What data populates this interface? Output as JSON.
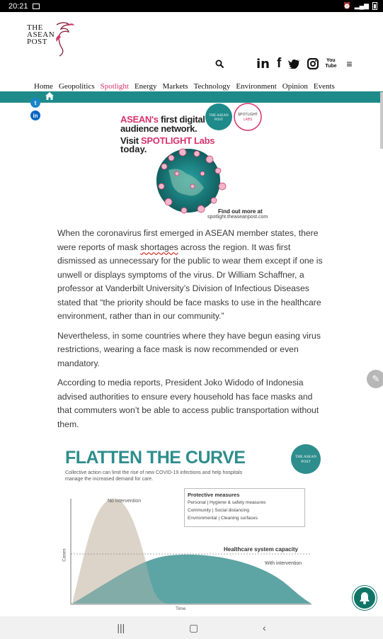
{
  "status_bar": {
    "time": "20:21"
  },
  "logo": {
    "text": [
      "THE",
      "ASEAN",
      "POST"
    ]
  },
  "social": {
    "icons": [
      "search-icon",
      "linkedin-icon",
      "facebook-icon",
      "twitter-icon",
      "instagram-icon",
      "youtube-icon",
      "menu-icon"
    ],
    "youtube_text": "You Tube"
  },
  "nav": {
    "items": [
      "Home",
      "Geopolitics",
      "Spotlight",
      "Energy",
      "Markets",
      "Technology",
      "Environment",
      "Opinion",
      "Events"
    ],
    "active": "Spotlight"
  },
  "ad": {
    "line1_pink": "ASEAN's ",
    "line1_dark": "first digital",
    "line2": "audience network.",
    "line3_dark": "Visit ",
    "line3_pink": "SPOTLIGHT Labs",
    "line4": "today.",
    "find": "Find out more at",
    "url": "spotlight.theaseanpost.com",
    "badge_text": "THE ASEAN POST",
    "badge2_text": "SPOTLIGHT LABS"
  },
  "article": {
    "p1_before": "When the coronavirus first emerged in ASEAN member states, there were reports of mask ",
    "p1_link": "shortages",
    "p1_after": " across the region. It was first dismissed as unnecessary for the public to wear them except if one is unwell or displays symptoms of the virus. Dr William Schaffner, a professor at Vanderbilt University’s Division of Infectious Diseases stated that “the priority should be face masks to use in the healthcare environment, rather than in our community.”",
    "p2": "Nevertheless, in some countries where they have begun easing virus restrictions, wearing a face mask is now recommended or even mandatory.",
    "p3": "According to media reports, President Joko Widodo of Indonesia advised authorities to ensure every household has face masks and that commuters won’t be able to access public transportation without them."
  },
  "infographic": {
    "title": "FLATTEN THE CURVE",
    "subtitle": "Collective action can limit the rise of new COVID-19 infections and help hospitals manage the increased demand for care.",
    "protective_title": "Protective measures",
    "protective": [
      {
        "label": "Personal",
        "value": "Hygiene & safety measures"
      },
      {
        "label": "Community",
        "value": "Social distancing"
      },
      {
        "label": "Environmental",
        "value": "Cleaning surfaces"
      }
    ],
    "no_intervention": "No intervention",
    "with_intervention": "With intervention",
    "capacity": "Healthcare system capacity",
    "ylabel": "Cases",
    "xlabel": "Time",
    "badge_text": "THE ASEAN POST"
  },
  "colors": {
    "teal": "#1e8a8a",
    "pink": "#d6336c",
    "beige": "#e6dccf",
    "chart_teal": "#4f9c9c"
  }
}
